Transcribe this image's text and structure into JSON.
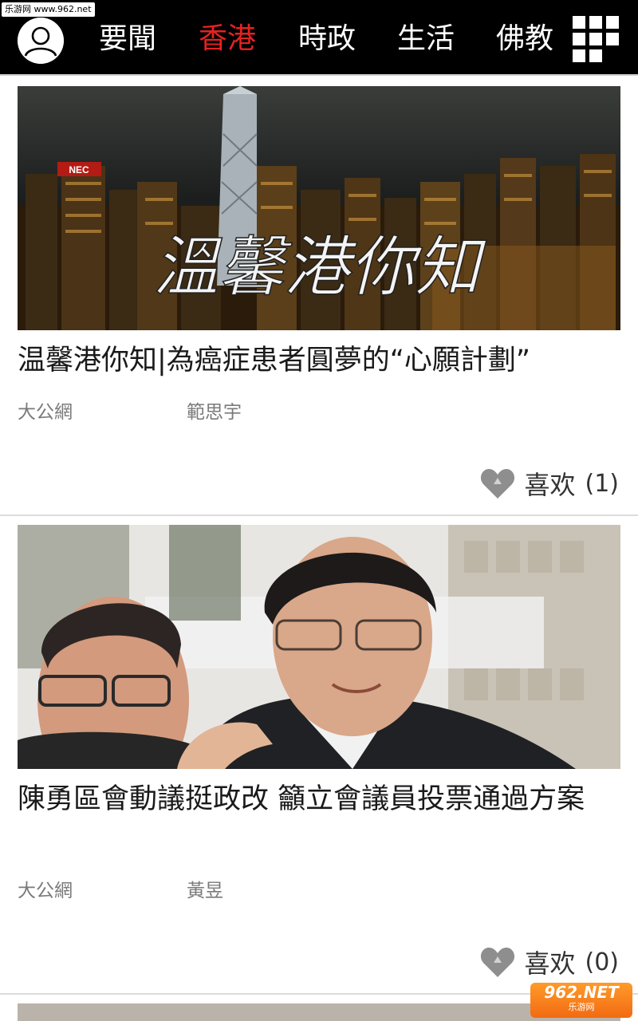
{
  "watermark_top": "乐游网 www.962.net",
  "nav": {
    "tabs": [
      {
        "label": "要聞",
        "active": false
      },
      {
        "label": "香港",
        "active": true
      },
      {
        "label": "時政",
        "active": false
      },
      {
        "label": "生活",
        "active": false
      },
      {
        "label": "佛教",
        "active": false
      }
    ],
    "active_color": "#e32222"
  },
  "articles": [
    {
      "image_overlay_text": "溫馨港你知",
      "title": "温馨港你知|為癌症患者圓夢的“心願計劃”",
      "source": "大公網",
      "author": "範思宇",
      "like_label": "喜欢",
      "like_count": "(1)"
    },
    {
      "title": "陳勇區會動議挺政改 籲立會議員投票通過方案",
      "source": "大公網",
      "author": "黃昱",
      "like_label": "喜欢",
      "like_count": "(0)"
    }
  ],
  "watermark_bottom": {
    "main": "962.NET",
    "sub": "乐游网"
  }
}
